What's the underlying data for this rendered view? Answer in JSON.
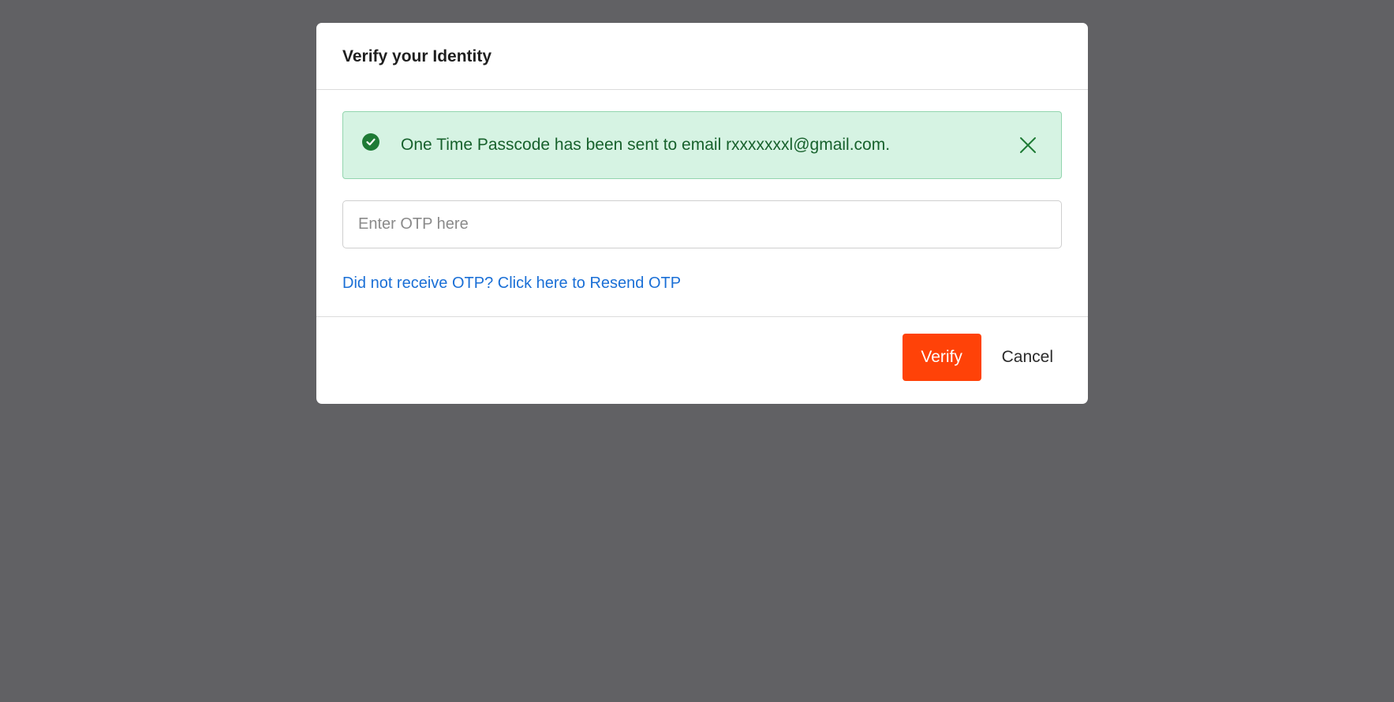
{
  "modal": {
    "title": "Verify your Identity",
    "alert": {
      "icon": "check-circle-icon",
      "message": "One Time Passcode has been sent to email rxxxxxxxl@gmail.com.",
      "close_icon": "close-icon",
      "background_color": "#d6f3e3",
      "text_color": "#17612c"
    },
    "otp_field": {
      "value": "",
      "placeholder": "Enter OTP here"
    },
    "resend_link": "Did not receive OTP? Click here to Resend OTP",
    "footer": {
      "verify_label": "Verify",
      "cancel_label": "Cancel",
      "verify_color": "#ff4208"
    }
  }
}
